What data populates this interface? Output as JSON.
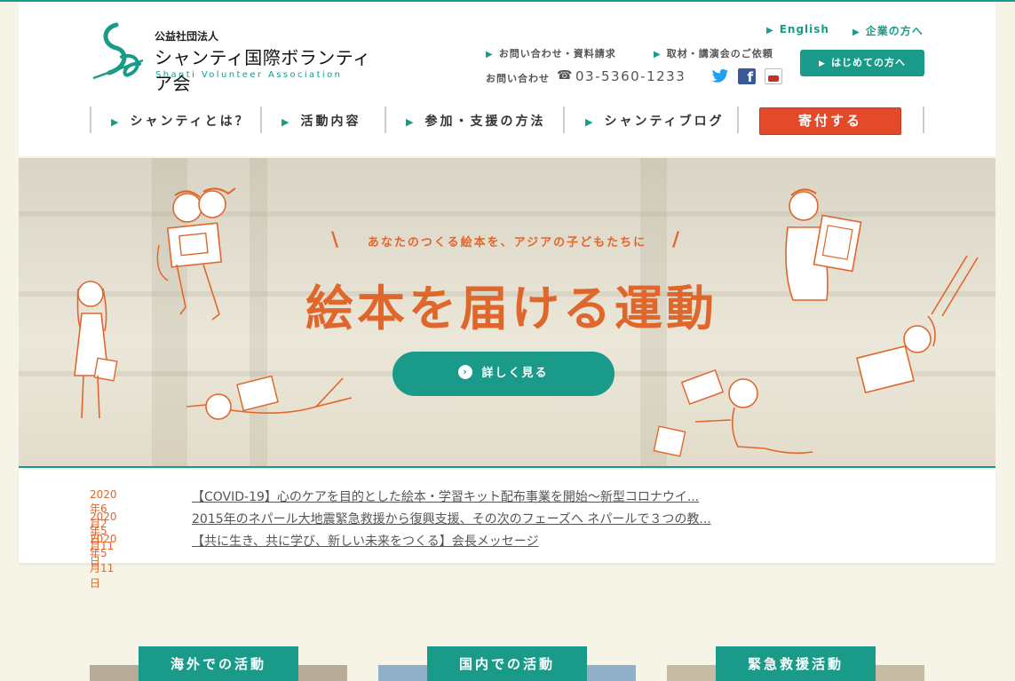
{
  "logo": {
    "corp": "公益社団法人",
    "name": "シャンティ国際ボランティア会",
    "en": "Shanti Volunteer Association"
  },
  "toplinks": {
    "english": "English",
    "corporate": "企業の方へ"
  },
  "utility": {
    "inquiry": "お問い合わせ・資料請求",
    "lecture": "取材・講演会のご依頼",
    "phone_label": "お問い合わせ",
    "phone_number": "03-5360-1233"
  },
  "buttons": {
    "beginner": "はじめての方へ",
    "donate": "寄付する"
  },
  "nav": [
    {
      "label": "シャンティとは？"
    },
    {
      "label": "活動内容"
    },
    {
      "label": "参加・支援の方法"
    },
    {
      "label": "シャンティブログ"
    }
  ],
  "hero": {
    "subtitle": "あなたのつくる絵本を、アジアの子どもたちに",
    "title": "絵本を届ける運動",
    "button": "詳しく見る"
  },
  "news": [
    {
      "date": "2020年6月2日",
      "title": "【COVID-19】心のケアを目的とした絵本・学習キット配布事業を開始〜新型コロナウイ..."
    },
    {
      "date": "2020年5月11日",
      "title": "2015年のネパール大地震緊急救援から復興支援、その次のフェーズへ ネパールで３つの教..."
    },
    {
      "date": "2020年5月11日",
      "title": "【共に生き、共に学び、新しい未来をつくる】会長メッセージ"
    }
  ],
  "sections": [
    {
      "label": "海外での活動"
    },
    {
      "label": "国内での活動"
    },
    {
      "label": "緊急救援活動"
    }
  ],
  "colors": {
    "accent": "#1a9b8a",
    "orange": "#e0672c",
    "donate": "#e34a2a"
  },
  "icons": [
    "twitter-icon",
    "facebook-icon",
    "youtube-icon",
    "phone-icon"
  ]
}
